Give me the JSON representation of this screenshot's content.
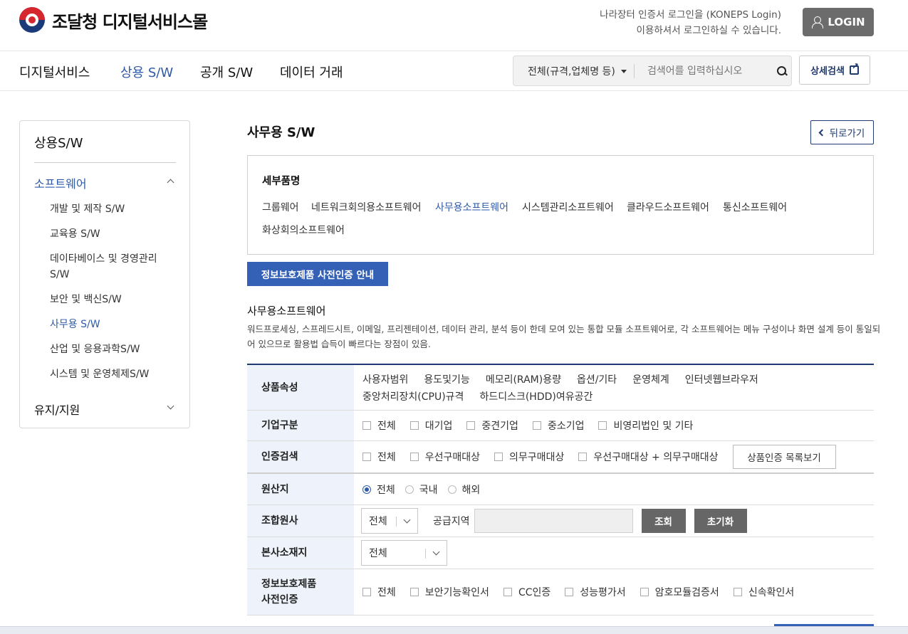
{
  "header": {
    "logo_text": "조달청 디지털서비스몰",
    "login_note_line1": "나라장터 인증서 로그인을 (KONEPS Login)",
    "login_note_line2": "이용하셔서 로그인하실 수 있습니다.",
    "login_label": "LOGIN"
  },
  "nav": {
    "items": [
      "디지털서비스",
      "상용 S/W",
      "공개 S/W",
      "데이터 거래"
    ],
    "active_index": 1,
    "search_scope": "전체(규격,업체명 등)",
    "search_placeholder": "검색어를 입력하십시오",
    "detail_search": "상세검색"
  },
  "sidebar": {
    "title": "상용S/W",
    "group_open": "소프트웨어",
    "items": [
      "개발 및 제작 S/W",
      "교육용 S/W",
      "데이타베이스 및 경영관리 S/W",
      "보안 및 백신S/W",
      "사무용 S/W",
      "산업 및 응용과학S/W",
      "시스템 및 운영체제S/W"
    ],
    "active_item": "사무용 S/W",
    "group_closed": "유지/지원"
  },
  "page": {
    "title": "사무용 S/W",
    "back_label": "뒤로가기",
    "detail_heading": "세부품명",
    "detail_items": [
      "그룹웨어",
      "네트워크회의용소프트웨어",
      "사무용소프트웨어",
      "시스템관리소프트웨어",
      "클라우드소프트웨어",
      "통신소프트웨어",
      "화상회의소프트웨어"
    ],
    "detail_active": "사무용소프트웨어",
    "guide_button": "정보보호제품 사전인증 안내",
    "desc_title": "사무용소프트웨어",
    "desc_text": "워드프로세싱, 스프레드시트, 이메일, 프리젠테이션, 데이터 관리, 분석 등이 한데 모여 있는 통합 모듈 소프트웨어로, 각 소프트웨어는 메뉴 구성이나 화면 설계 등이 통일되어 있으므로 활용법 습득이 빠르다는 장점이 있음."
  },
  "filters": {
    "attr_label": "상품속성",
    "attr_tags": [
      "사용자범위",
      "용도및기능",
      "메모리(RAM)용량",
      "옵션/기타",
      "운영체계",
      "인터넷웹브라우저",
      "중앙처리장치(CPU)규격",
      "하드디스크(HDD)여유공간"
    ],
    "company_label": "기업구분",
    "company_options": [
      "전체",
      "대기업",
      "중견기업",
      "중소기업",
      "비영리법인 및 기타"
    ],
    "cert_label": "인증검색",
    "cert_options": [
      "전체",
      "우선구매대상",
      "의무구매대상",
      "우선구매대상 + 의무구매대상"
    ],
    "cert_list_button": "상품인증 목록보기",
    "origin_label": "원산지",
    "origin_options": [
      "전체",
      "국내",
      "해외"
    ],
    "origin_selected": "전체",
    "union_label": "조합원사",
    "union_select": "전체",
    "supply_label": "공급지역",
    "search_button": "조회",
    "reset_button": "초기화",
    "hq_label": "본사소재지",
    "hq_select": "전체",
    "security_label_line1": "정보보호제품",
    "security_label_line2": "사전인증",
    "security_options": [
      "전체",
      "보안기능확인서",
      "CC인증",
      "성능평가서",
      "암호모듈검증서",
      "신속확인서"
    ]
  }
}
